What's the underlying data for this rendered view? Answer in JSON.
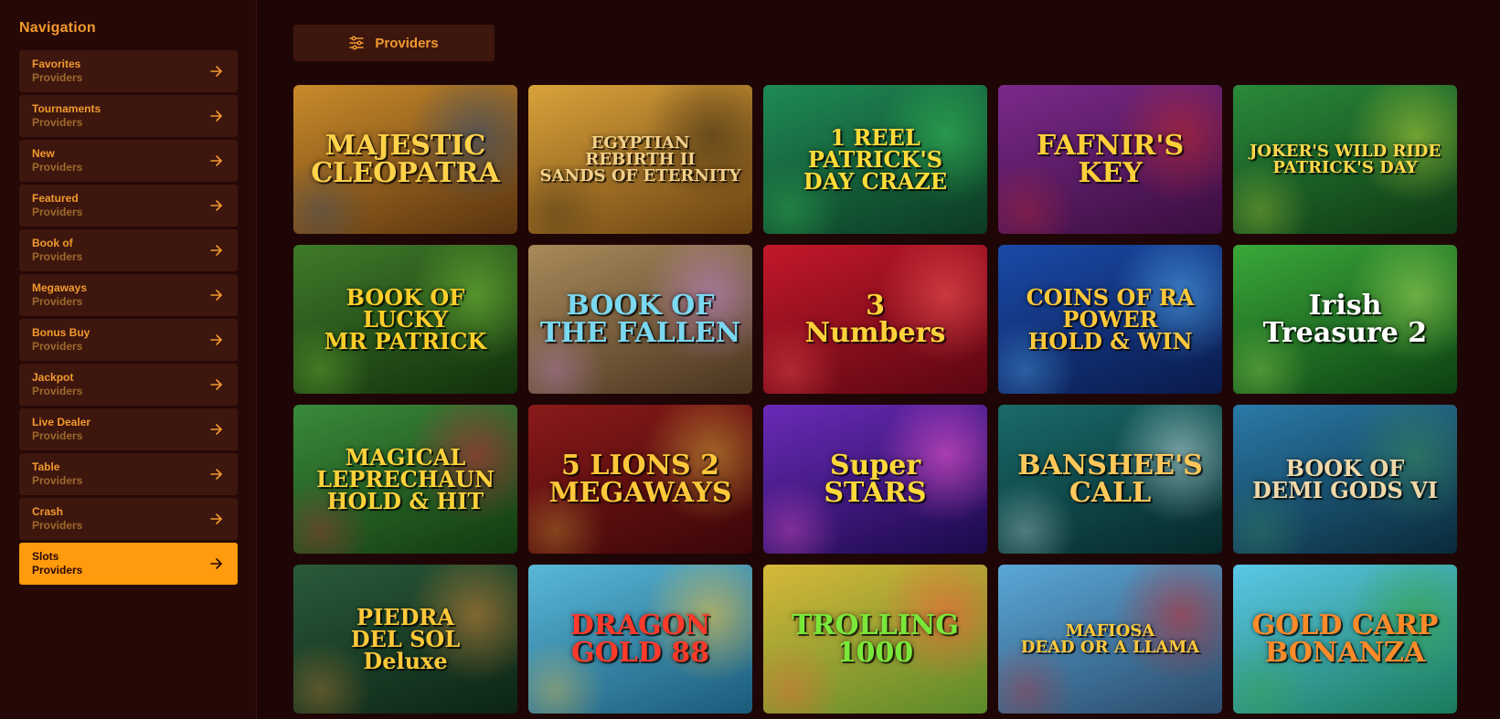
{
  "sidebar": {
    "title": "Navigation",
    "items": [
      {
        "label": "Favorites",
        "sub": "Providers",
        "active": false
      },
      {
        "label": "Tournaments",
        "sub": "Providers",
        "active": false
      },
      {
        "label": "New",
        "sub": "Providers",
        "active": false
      },
      {
        "label": "Featured",
        "sub": "Providers",
        "active": false
      },
      {
        "label": "Book of",
        "sub": "Providers",
        "active": false
      },
      {
        "label": "Megaways",
        "sub": "Providers",
        "active": false
      },
      {
        "label": "Bonus Buy",
        "sub": "Providers",
        "active": false
      },
      {
        "label": "Jackpot",
        "sub": "Providers",
        "active": false
      },
      {
        "label": "Live Dealer",
        "sub": "Providers",
        "active": false
      },
      {
        "label": "Table",
        "sub": "Providers",
        "active": false
      },
      {
        "label": "Crash",
        "sub": "Providers",
        "active": false
      },
      {
        "label": "Slots",
        "sub": "Providers",
        "active": true
      }
    ]
  },
  "main": {
    "providers_label": "Providers",
    "games": [
      {
        "title": "MAJESTIC\nCLEOPATRA",
        "bg": [
          "#c98a2a",
          "#5a3410"
        ],
        "fg": "#ffd24a",
        "accent": "#2a4d7a"
      },
      {
        "title": "EGYPTIAN\nREBIRTH II\nSANDS OF ETERNITY",
        "bg": [
          "#d9a23a",
          "#6b4312"
        ],
        "fg": "#f3d08a",
        "accent": "#3b2a12"
      },
      {
        "title": "1 REEL\nPATRICK'S\nDAY CRAZE",
        "bg": [
          "#1f8a55",
          "#0c3a22"
        ],
        "fg": "#ffdb3a",
        "accent": "#38c35a"
      },
      {
        "title": "FAFNIR'S\nKEY",
        "bg": [
          "#7a2a8a",
          "#3a0d3f"
        ],
        "fg": "#ffcf3a",
        "accent": "#c8282a"
      },
      {
        "title": "JOKER'S WILD RIDE\nPATRICK'S DAY",
        "bg": [
          "#2a8a3a",
          "#0e3814"
        ],
        "fg": "#ffd84a",
        "accent": "#b8d83a"
      },
      {
        "title": "BOOK OF\nLUCKY\nMR PATRICK",
        "bg": [
          "#3f7a2a",
          "#12300c"
        ],
        "fg": "#ffce2a",
        "accent": "#7ac83a"
      },
      {
        "title": "BOOK OF\nTHE FALLEN",
        "bg": [
          "#a88a5a",
          "#4a3420"
        ],
        "fg": "#7ad8f0",
        "accent": "#c88ae0"
      },
      {
        "title": "3\nNumbers",
        "bg": [
          "#c2182a",
          "#5a0612"
        ],
        "fg": "#ffd23a",
        "accent": "#ff5a5a"
      },
      {
        "title": "COINS OF RA\nPOWER\nHOLD & WIN",
        "bg": [
          "#1a4aa8",
          "#0a1a4a"
        ],
        "fg": "#ffc83a",
        "accent": "#5ab8ff"
      },
      {
        "title": "Irish\nTreasure 2",
        "bg": [
          "#3aa83a",
          "#0c4012"
        ],
        "fg": "#ffffff",
        "accent": "#a8e05a"
      },
      {
        "title": "MAGICAL\nLEPRECHAUN\nHOLD & HIT",
        "bg": [
          "#3a8a3a",
          "#123a10"
        ],
        "fg": "#ffd23a",
        "accent": "#c8283a"
      },
      {
        "title": "5 LIONS 2\nMEGAWAYS",
        "bg": [
          "#8a1a1a",
          "#3a0608"
        ],
        "fg": "#ffc83a",
        "accent": "#d8a83a"
      },
      {
        "title": "Super\nSTARS",
        "bg": [
          "#6a2ab8",
          "#1a0a4a"
        ],
        "fg": "#ffd83a",
        "accent": "#ff5ad8"
      },
      {
        "title": "BANSHEE'S\nCALL",
        "bg": [
          "#1a6a6a",
          "#06282a"
        ],
        "fg": "#ffc85a",
        "accent": "#c8e8e8"
      },
      {
        "title": "BOOK OF\nDEMI GODS VI",
        "bg": [
          "#2a7aa8",
          "#0a2a3a"
        ],
        "fg": "#f0d8a8",
        "accent": "#3a8a5a"
      },
      {
        "title": "PIEDRA\nDEL SOL\nDeluxe",
        "bg": [
          "#2a5a3a",
          "#0c2414"
        ],
        "fg": "#ffc83a",
        "accent": "#d88a3a"
      },
      {
        "title": "DRAGON\nGOLD 88",
        "bg": [
          "#5ab8d8",
          "#1a5a7a"
        ],
        "fg": "#ff3a2a",
        "accent": "#ffc83a"
      },
      {
        "title": "TROLLING\n1000",
        "bg": [
          "#d8b83a",
          "#5a8a2a"
        ],
        "fg": "#7ae83a",
        "accent": "#ff5a3a"
      },
      {
        "title": "MAFIOSA\nDEAD OR A LLAMA",
        "bg": [
          "#5aa8d8",
          "#2a4a6a"
        ],
        "fg": "#ffc83a",
        "accent": "#c8282a"
      },
      {
        "title": "GOLD CARP\nBONANZA",
        "bg": [
          "#5ac8e8",
          "#1a7a5a"
        ],
        "fg": "#ff8a2a",
        "accent": "#3aa83a"
      }
    ]
  },
  "colors": {
    "page_bg": "#1f0606",
    "sidebar_bg": "#260807",
    "item_bg": "#3d160e",
    "accent": "#ff9b0c",
    "text": "#f29a2e",
    "muted": "#9e6a2a"
  },
  "icons": {
    "arrow": "arrow-right-icon",
    "providers": "sliders-icon"
  }
}
